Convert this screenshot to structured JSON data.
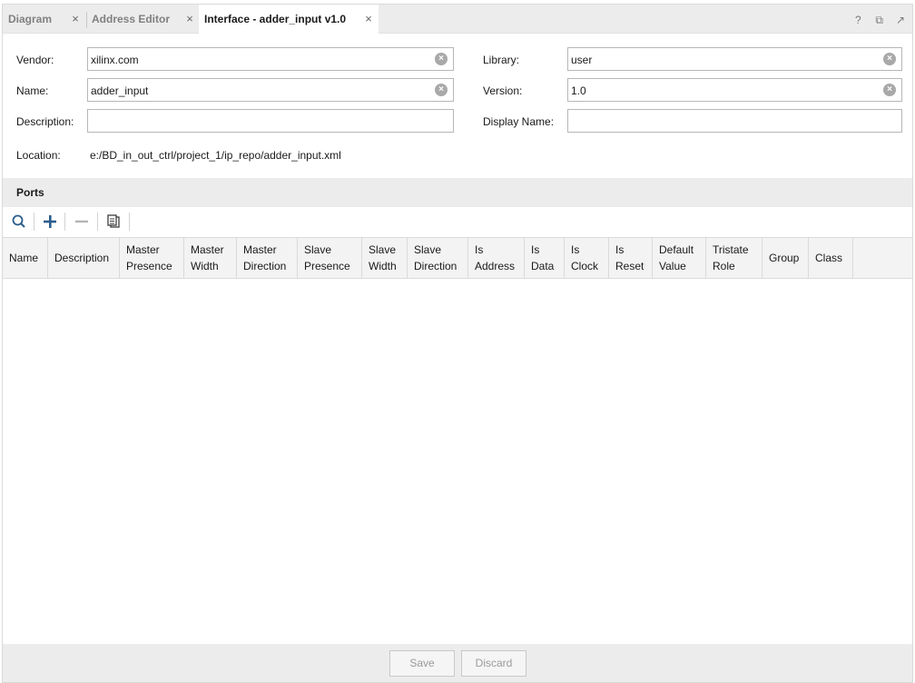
{
  "tabs": [
    {
      "label": "Diagram",
      "closable": true,
      "active": false
    },
    {
      "label": "Address Editor",
      "closable": true,
      "active": false
    },
    {
      "label": "Interface - adder_input v1.0",
      "closable": true,
      "active": true
    }
  ],
  "window_controls": {
    "help": "?",
    "restore": "⧉",
    "undock": "↗"
  },
  "form": {
    "vendor": {
      "label": "Vendor:",
      "value": "xilinx.com"
    },
    "name": {
      "label": "Name:",
      "value": "adder_input"
    },
    "description": {
      "label": "Description:",
      "value": ""
    },
    "location": {
      "label": "Location:",
      "value": "e:/BD_in_out_ctrl/project_1/ip_repo/adder_input.xml"
    },
    "library": {
      "label": "Library:",
      "value": "user"
    },
    "version": {
      "label": "Version:",
      "value": "1.0"
    },
    "display_name": {
      "label": "Display Name:",
      "value": ""
    }
  },
  "ports": {
    "title": "Ports",
    "toolbar": [
      "search-icon",
      "add-icon",
      "remove-icon",
      "copy-icon"
    ],
    "columns": [
      [
        "Name"
      ],
      [
        "Description"
      ],
      [
        "Master",
        "Presence"
      ],
      [
        "Master",
        "Width"
      ],
      [
        "Master",
        "Direction"
      ],
      [
        "Slave",
        "Presence"
      ],
      [
        "Slave",
        "Width"
      ],
      [
        "Slave",
        "Direction"
      ],
      [
        "Is",
        "Address"
      ],
      [
        "Is",
        "Data"
      ],
      [
        "Is",
        "Clock"
      ],
      [
        "Is",
        "Reset"
      ],
      [
        "Default",
        "Value"
      ],
      [
        "Tristate",
        "Role"
      ],
      [
        "Group"
      ],
      [
        "Class"
      ]
    ],
    "rows": []
  },
  "footer": {
    "save_label": "Save",
    "discard_label": "Discard"
  }
}
